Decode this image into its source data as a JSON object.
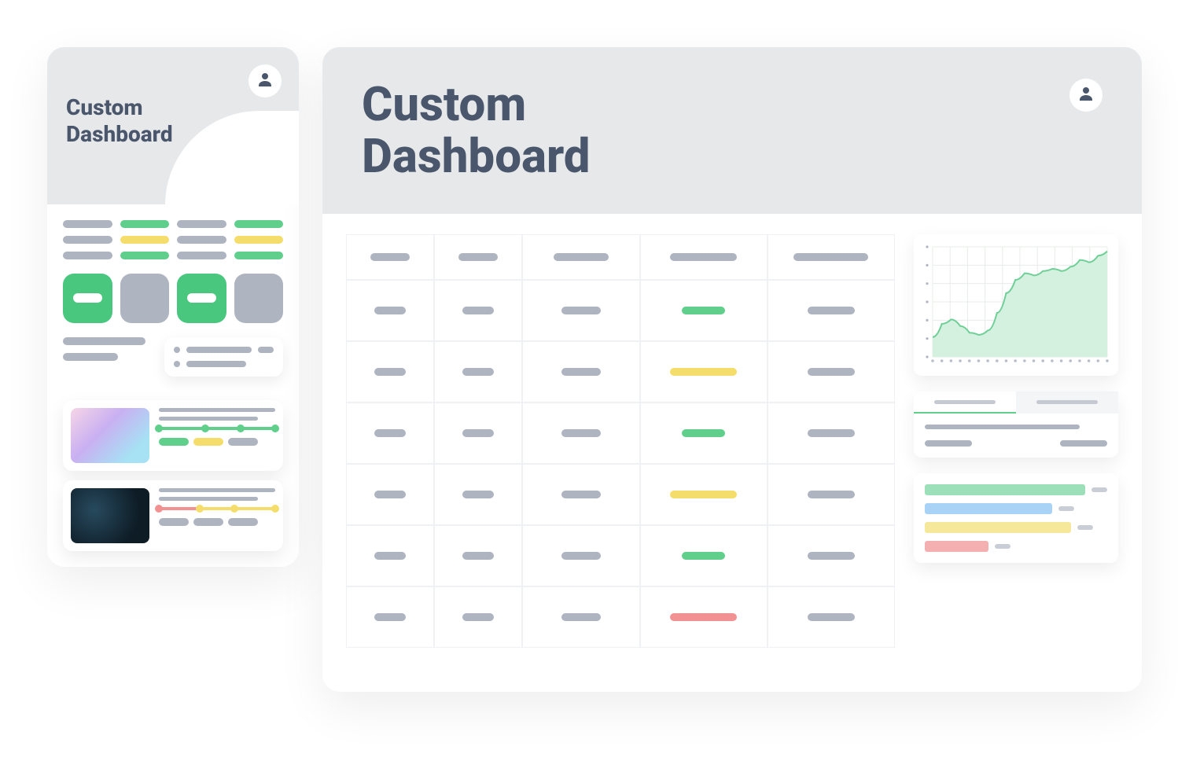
{
  "mobile": {
    "title": "Custom\nDashboard",
    "pills": [
      [
        "grey",
        "green",
        "grey",
        "green"
      ],
      [
        "grey",
        "yellow",
        "grey",
        "yellow"
      ],
      [
        "grey",
        "green",
        "grey",
        "green"
      ]
    ],
    "tiles": [
      {
        "color": "green",
        "dash": true
      },
      {
        "color": "grey",
        "dash": false
      },
      {
        "color": "green",
        "dash": true
      },
      {
        "color": "grey",
        "dash": false
      }
    ],
    "media_cards": [
      {
        "thumb": "purple",
        "progress": {
          "segments": [
            {
              "start": 0,
              "end": 40,
              "color": "#5fcf8b"
            },
            {
              "start": 40,
              "end": 70,
              "color": "#5fcf8b"
            },
            {
              "start": 70,
              "end": 100,
              "color": "#5fcf8b"
            }
          ],
          "markers": [
            {
              "pos": 0,
              "color": "#5fcf8b"
            },
            {
              "pos": 40,
              "color": "#5fcf8b"
            },
            {
              "pos": 70,
              "color": "#5fcf8b"
            },
            {
              "pos": 100,
              "color": "#5fcf8b"
            }
          ]
        },
        "tags": [
          "green",
          "yellow",
          "grey"
        ]
      },
      {
        "thumb": "dark",
        "progress": {
          "segments": [
            {
              "start": 0,
              "end": 35,
              "color": "#f29191"
            },
            {
              "start": 35,
              "end": 65,
              "color": "#f4dd6b"
            },
            {
              "start": 65,
              "end": 100,
              "color": "#f4dd6b"
            }
          ],
          "markers": [
            {
              "pos": 0,
              "color": "#f29191"
            },
            {
              "pos": 35,
              "color": "#f4dd6b"
            },
            {
              "pos": 65,
              "color": "#f4dd6b"
            },
            {
              "pos": 100,
              "color": "#f4dd6b"
            }
          ]
        },
        "tags": [
          "grey",
          "grey",
          "grey"
        ]
      }
    ]
  },
  "desktop": {
    "title": "Custom\nDashboard",
    "table": {
      "columns": 5,
      "rows": [
        [
          {
            "c": "grey",
            "w": "w50"
          },
          {
            "c": "grey",
            "w": "w50"
          },
          {
            "c": "grey",
            "w": "w70"
          },
          {
            "c": "grey",
            "w": "w85"
          },
          {
            "c": "grey",
            "w": "w95"
          }
        ],
        [
          {
            "c": "grey",
            "w": "w40"
          },
          {
            "c": "grey",
            "w": "w40"
          },
          {
            "c": "grey",
            "w": "w50"
          },
          {
            "c": "green",
            "w": "w55"
          },
          {
            "c": "grey",
            "w": "w60"
          }
        ],
        [
          {
            "c": "grey",
            "w": "w40"
          },
          {
            "c": "grey",
            "w": "w40"
          },
          {
            "c": "grey",
            "w": "w50"
          },
          {
            "c": "yellow",
            "w": "w85"
          },
          {
            "c": "grey",
            "w": "w60"
          }
        ],
        [
          {
            "c": "grey",
            "w": "w40"
          },
          {
            "c": "grey",
            "w": "w40"
          },
          {
            "c": "grey",
            "w": "w50"
          },
          {
            "c": "green",
            "w": "w55"
          },
          {
            "c": "grey",
            "w": "w60"
          }
        ],
        [
          {
            "c": "grey",
            "w": "w40"
          },
          {
            "c": "grey",
            "w": "w40"
          },
          {
            "c": "grey",
            "w": "w50"
          },
          {
            "c": "yellow",
            "w": "w85"
          },
          {
            "c": "grey",
            "w": "w60"
          }
        ],
        [
          {
            "c": "grey",
            "w": "w40"
          },
          {
            "c": "grey",
            "w": "w40"
          },
          {
            "c": "grey",
            "w": "w50"
          },
          {
            "c": "green",
            "w": "w55"
          },
          {
            "c": "grey",
            "w": "w60"
          }
        ],
        [
          {
            "c": "grey",
            "w": "w40"
          },
          {
            "c": "grey",
            "w": "w40"
          },
          {
            "c": "grey",
            "w": "w50"
          },
          {
            "c": "red",
            "w": "w85"
          },
          {
            "c": "grey",
            "w": "w60"
          }
        ]
      ]
    },
    "bars": [
      {
        "color": "green",
        "pct": 90
      },
      {
        "color": "blue",
        "pct": 70
      },
      {
        "color": "yellow",
        "pct": 80
      },
      {
        "color": "red",
        "pct": 35
      }
    ]
  },
  "colors": {
    "grey": "#aeb4c0",
    "green": "#5fcf8b",
    "yellow": "#f4dd6b",
    "red": "#f29191",
    "text": "#49566b",
    "panel": "#e7e8ea"
  },
  "chart_data": {
    "type": "area",
    "x": [
      0,
      1,
      2,
      3,
      4,
      5,
      6,
      7,
      8,
      9,
      10,
      11,
      12,
      13,
      14,
      15,
      16,
      17,
      18,
      19
    ],
    "values": [
      18,
      30,
      34,
      28,
      22,
      20,
      24,
      40,
      58,
      70,
      76,
      74,
      78,
      80,
      78,
      82,
      88,
      86,
      92,
      96
    ],
    "ylim": [
      0,
      100
    ],
    "grid": true,
    "color": "#9be0b8",
    "title": "",
    "xlabel": "",
    "ylabel": ""
  }
}
